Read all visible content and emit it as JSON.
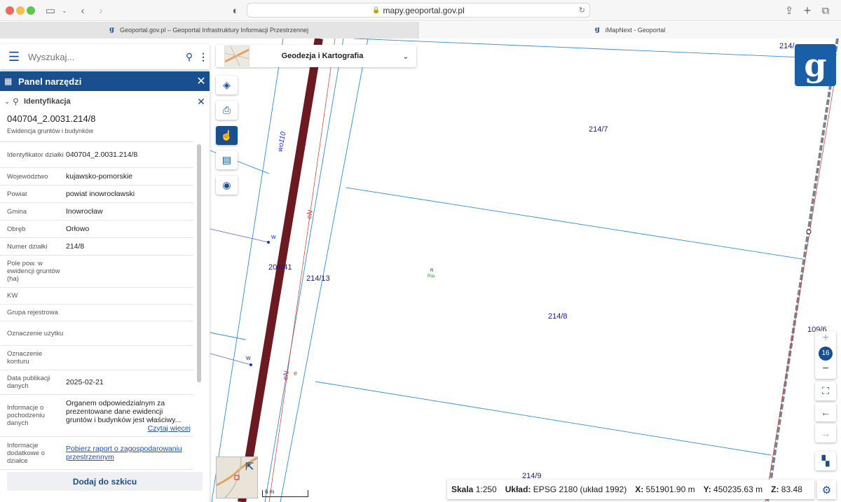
{
  "browser": {
    "url": "mapy.geoportal.gov.pl",
    "tabs": [
      {
        "title": "Geoportal.gov.pl – Geoportal Infrastruktury Informacji Przestrzennej"
      },
      {
        "title": "iMapNext - Geoportal"
      }
    ]
  },
  "search": {
    "placeholder": "Wyszukaj..."
  },
  "panel": {
    "title": "Panel narzędzi",
    "section": "Identyfikacja",
    "parcel_id": "040704_2.0031.214/8",
    "subtitle": "Ewidencja gruntów i budynków",
    "rows": [
      {
        "key": "Identyfikator działki",
        "value": "040704_2.0031.214/8"
      },
      {
        "key": "Województwo",
        "value": "kujawsko-pomorskie"
      },
      {
        "key": "Powiat",
        "value": "powiat inowrocławski"
      },
      {
        "key": "Gmina",
        "value": "Inowrocław"
      },
      {
        "key": "Obręb",
        "value": "Orłowo"
      },
      {
        "key": "Numer działki",
        "value": "214/8"
      },
      {
        "key": "Pole pow. w ewidencji gruntów (ha)",
        "value": ""
      },
      {
        "key": "KW",
        "value": ""
      },
      {
        "key": "Grupa rejestrowa",
        "value": ""
      },
      {
        "key": "Oznaczenie użytku",
        "value": ""
      },
      {
        "key": "Oznaczenie konturu",
        "value": ""
      },
      {
        "key": "Data publikacji danych",
        "value": "2025-02-21"
      },
      {
        "key": "Informacje o pochodzeniu danych",
        "value": "Organem odpowiedzialnym za prezentowane dane ewidencji gruntów i budynków jest właściwy...",
        "link": "Czytaj więcej"
      },
      {
        "key": "Informacje dodatkowe o działce",
        "value": "",
        "link": "Pobierz raport o zagospodarowaniu przestrzennym"
      }
    ],
    "add_button": "Dodaj do szkicu"
  },
  "theme": {
    "label": "Geodezja i Kartografia"
  },
  "map_labels": {
    "parcels": [
      "214/7",
      "214/13",
      "214/8",
      "214/9",
      "204/41",
      "109/6",
      "214/"
    ],
    "road": "wo110",
    "network": "eN",
    "point_w": "w",
    "small_r": "R",
    "small_rila": "Rila",
    "e": "e"
  },
  "zoom": {
    "level": "16",
    "plus": "+",
    "minus": "−"
  },
  "scale": {
    "label": "6 m"
  },
  "status": {
    "scale_label": "Skala",
    "scale_value": "1:250",
    "crs_label": "Układ:",
    "crs_value": "EPSG 2180 (układ 1992)",
    "x_label": "X:",
    "x_value": "551901.90 m",
    "y_label": "Y:",
    "y_value": "450235.63 m",
    "z_label": "Z:",
    "z_value": "83.48"
  },
  "colors": {
    "brand": "#1a4f8f",
    "parcel_line": "#2e8ee0",
    "road": "#6b1a22",
    "network": "#e03030"
  }
}
